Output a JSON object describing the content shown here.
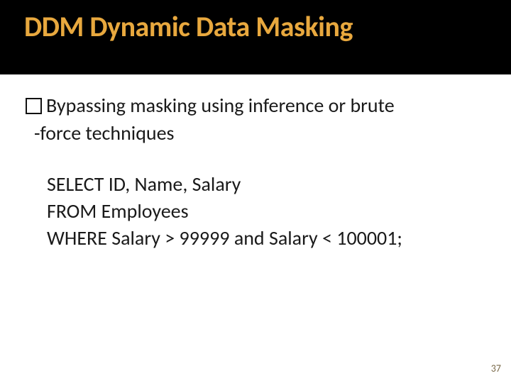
{
  "title": "DDM Dynamic Data Masking",
  "bullet": {
    "line1": "Bypassing masking using inference or brute",
    "line2": "-force techniques"
  },
  "code": {
    "line1": "SELECT ID, Name, Salary",
    "line2": "FROM Employees",
    "line3": "WHERE Salary > 99999 and Salary < 100001;"
  },
  "page_number": "37"
}
